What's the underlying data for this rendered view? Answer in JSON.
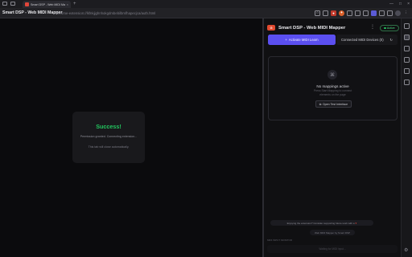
{
  "browser": {
    "tab_title": "Smart DSP - Web MIDI Mapper",
    "tab_close": "×",
    "new_tab": "+",
    "window_controls": [
      "—",
      "□",
      "×"
    ],
    "page_title": "Smart DSP - Web MIDI Mapper",
    "url": "chrome-extension://lkfnkjjghnhokgdmbebilbmfhapecjca/auth.html"
  },
  "page": {
    "card": {
      "title": "Success!",
      "message": "Permission granted. Connecting extension...",
      "note": "This tab will close automatically."
    }
  },
  "panel": {
    "title": "Smart DSP - Web MIDI Mapper",
    "status": "Active",
    "activate_button": "Activate MIDI Learn",
    "devices_button": "Connected MIDI Devices (0)",
    "mappings": {
      "title": "No mappings active",
      "desc_line1": "Press Start Mapping to connect",
      "desc_line2": "elements on the page",
      "open_test": "Open Test Interface"
    },
    "banner": "Enjoying the extension? Consider supporting future work with a",
    "chip": "Web MIDI Mapper by Smart DSP",
    "footer_label": "MIDI INPUT MONITOR",
    "input_placeholder": "Waiting for MIDI input..."
  },
  "colors": {
    "accent": "#5b4ff0",
    "success": "#22c55e",
    "brand": "#e24a2f",
    "background": "#0b0b0d"
  },
  "icons": {
    "logo": "smart-dsp-logo",
    "mapping": "link-off-icon",
    "test": "external-icon",
    "heart": "heart-icon"
  }
}
